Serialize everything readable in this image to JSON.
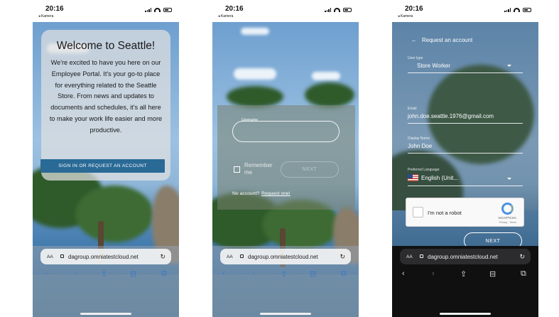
{
  "status": {
    "time": "20:16",
    "back_app": "◂ Kamera"
  },
  "screen1": {
    "title": "Welcome to Seattle!",
    "body": "We're excited to have you here on our Employee Portal. It's your go-to place for everything related to the Seattle Store. From news and updates to documents and schedules, it's all here to make your work life easier and more productive.",
    "signin_button": "SIGN IN OR REQUEST AN ACCOUNT"
  },
  "screen2": {
    "username_label": "Username",
    "remember_label": "Remember me",
    "next_label": "NEXT",
    "no_account_text": "No account?",
    "request_link": "Request one!"
  },
  "screen3": {
    "header": "Request an account",
    "user_type_label": "User type",
    "user_type_value": "Store Worker",
    "email_label": "Email",
    "email_value": "john.doe.seattle.1976@gmail.com",
    "display_name_label": "Display Name",
    "display_name_value": "John Doe",
    "language_label": "Preferred Language",
    "language_value": "English (Unit...",
    "captcha_text": "I'm not a robot",
    "captcha_brand": "reCAPTCHA",
    "captcha_links": "Privacy - Terms",
    "next_label": "NEXT"
  },
  "safari": {
    "aa": "AA",
    "url": "dagroup.omniatestcloud.net"
  }
}
